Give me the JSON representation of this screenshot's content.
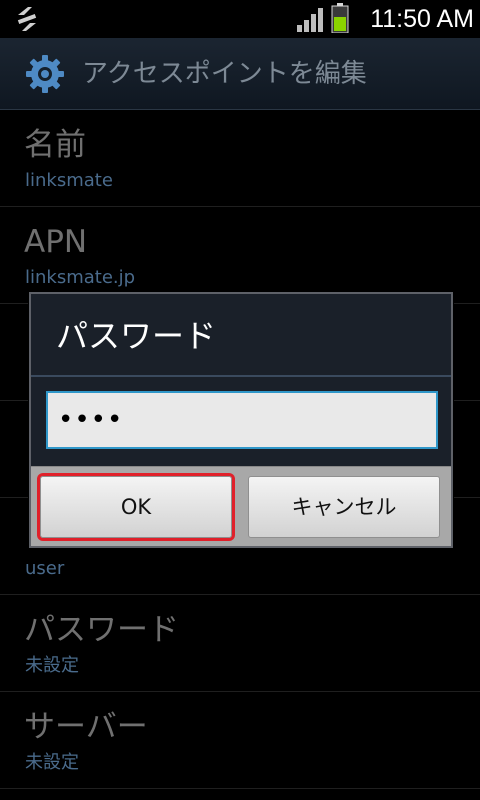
{
  "status_bar": {
    "time": "11:50 AM",
    "icons": [
      "usb-icon",
      "signal-icon",
      "battery-icon"
    ],
    "battery_color": "#8bd400"
  },
  "title_bar": {
    "title": "アクセスポイントを編集",
    "icon": "settings-gear-icon"
  },
  "list": {
    "items": [
      {
        "title": "名前",
        "value": "linksmate"
      },
      {
        "title": "APN",
        "value": "linksmate.jp"
      },
      {
        "title": "",
        "value": ""
      },
      {
        "title": "",
        "value": ""
      },
      {
        "title": "",
        "value": "user"
      },
      {
        "title": "パスワード",
        "value": "未設定"
      },
      {
        "title": "サーバー",
        "value": "未設定"
      }
    ]
  },
  "dialog": {
    "title": "パスワード",
    "input_value": "••••",
    "ok_label": "OK",
    "cancel_label": "キャンセル",
    "highlight_color": "#e0202a",
    "accent_color": "#2f97c9"
  }
}
